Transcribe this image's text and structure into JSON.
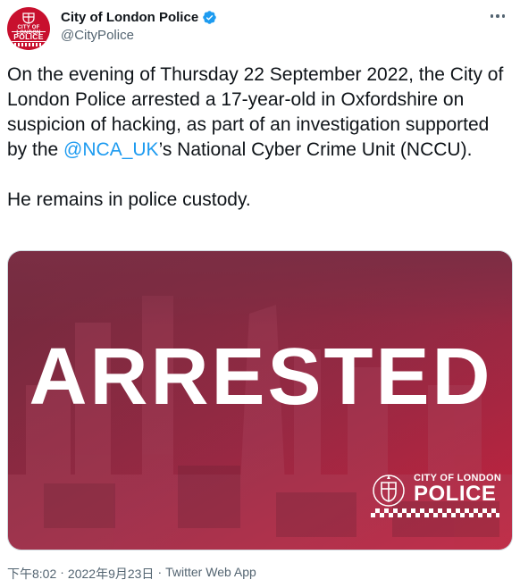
{
  "author": {
    "display_name": "City of London Police",
    "handle": "@CityPolice",
    "verified": true,
    "avatar": {
      "line1": "CITY OF LONDON",
      "line2": "POLICE"
    }
  },
  "tweet": {
    "text_before_mention": "On the evening of Thursday 22 September 2022, the City of London Police arrested a 17-year-old in Oxfordshire on suspicion of hacking, as part of an investigation supported by the ",
    "mention": "@NCA_UK",
    "text_after_mention": "’s National Cyber Crime Unit (NCCU).\n\nHe remains in police custody."
  },
  "media": {
    "headline": "ARRESTED",
    "logo_line1": "CITY OF LONDON",
    "logo_line2": "POLICE"
  },
  "meta": {
    "time": "下午8:02",
    "separator": "·",
    "date": "2022年9月23日",
    "source": "Twitter Web App"
  },
  "colors": {
    "link": "#1d9bf0",
    "verified": "#1d9bf0",
    "brand_red": "#c8102e",
    "image_overlay_top": "#7a2a3e",
    "image_overlay_bottom": "#c8203c"
  },
  "icons": {
    "verified": "verified-badge-icon",
    "more": "more-options-icon"
  }
}
